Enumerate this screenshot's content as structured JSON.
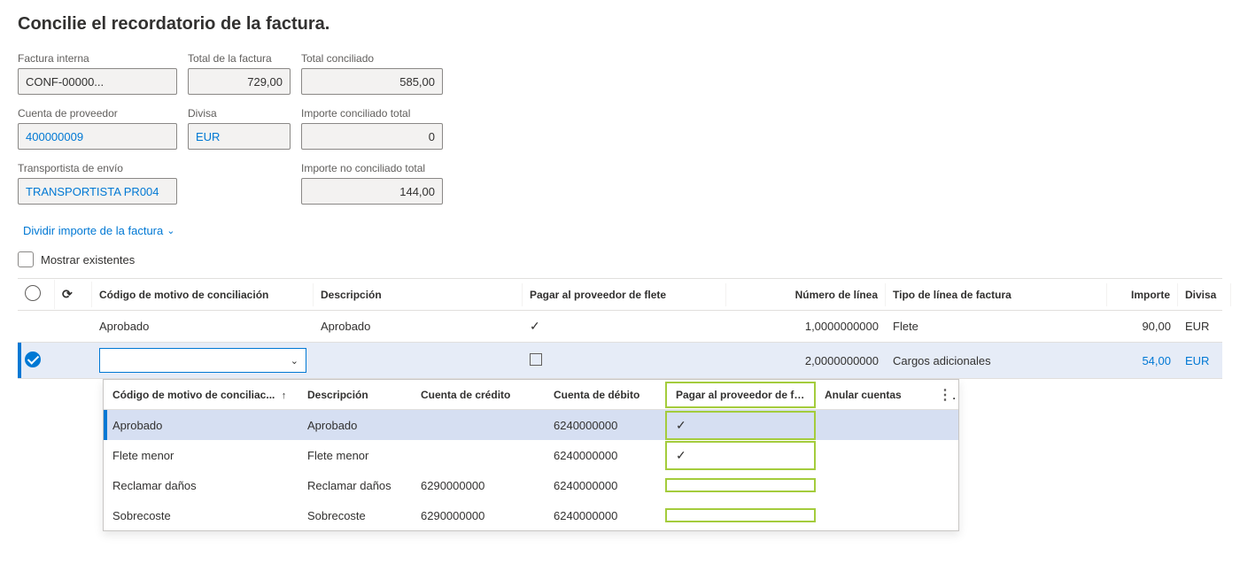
{
  "page_title": "Concilie el recordatorio de la factura.",
  "form": {
    "internal_invoice_label": "Factura interna",
    "internal_invoice_value": "CONF-00000...",
    "invoice_total_label": "Total de la factura",
    "invoice_total_value": "729,00",
    "reconciled_total_label": "Total conciliado",
    "reconciled_total_value": "585,00",
    "vendor_account_label": "Cuenta de proveedor",
    "vendor_account_value": "400000009",
    "currency_label": "Divisa",
    "currency_value": "EUR",
    "reconciled_amount_label": "Importe conciliado total",
    "reconciled_amount_value": "0",
    "carrier_label": "Transportista de envío",
    "carrier_value": "TRANSPORTISTA PR004",
    "unreconciled_amount_label": "Importe no conciliado total",
    "unreconciled_amount_value": "144,00"
  },
  "split_link": "Dividir importe de la factura",
  "show_existing_label": "Mostrar existentes",
  "grid": {
    "headers": {
      "reason_code": "Código de motivo de conciliación",
      "description": "Descripción",
      "pay_freight": "Pagar al proveedor de flete",
      "line_number": "Número de línea",
      "line_type": "Tipo de línea de factura",
      "amount": "Importe",
      "currency": "Divisa"
    },
    "rows": [
      {
        "selected": false,
        "reason_code": "Aprobado",
        "description": "Aprobado",
        "pay_freight": "✓",
        "line_number": "1,0000000000",
        "line_type": "Flete",
        "amount": "90,00",
        "currency": "EUR"
      },
      {
        "selected": true,
        "reason_code": "",
        "description": "",
        "pay_freight": "☐",
        "line_number": "2,0000000000",
        "line_type": "Cargos adicionales",
        "amount": "54,00",
        "currency": "EUR"
      }
    ]
  },
  "popup": {
    "headers": {
      "reason_code": "Código de motivo de conciliac...",
      "description": "Descripción",
      "credit_account": "Cuenta de crédito",
      "debit_account": "Cuenta de débito",
      "pay_freight": "Pagar al proveedor de flete",
      "override": "Anular cuentas"
    },
    "rows": [
      {
        "selected": true,
        "reason_code": "Aprobado",
        "description": "Aprobado",
        "credit": "",
        "debit": "6240000000",
        "pay_freight": "✓",
        "override": ""
      },
      {
        "selected": false,
        "reason_code": "Flete menor",
        "description": "Flete menor",
        "credit": "",
        "debit": "6240000000",
        "pay_freight": "✓",
        "override": ""
      },
      {
        "selected": false,
        "reason_code": "Reclamar daños",
        "description": "Reclamar daños",
        "credit": "6290000000",
        "debit": "6240000000",
        "pay_freight": "",
        "override": ""
      },
      {
        "selected": false,
        "reason_code": "Sobrecoste",
        "description": "Sobrecoste",
        "credit": "6290000000",
        "debit": "6240000000",
        "pay_freight": "",
        "override": ""
      }
    ]
  }
}
